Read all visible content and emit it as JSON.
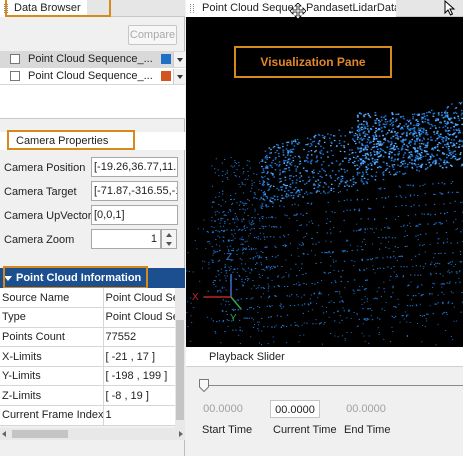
{
  "left": {
    "tab_label": "Data Browser",
    "compare_label": "Compare",
    "datasets": [
      {
        "label": "Point Cloud Sequence_...",
        "color": "#1f6fc4"
      },
      {
        "label": "Point Cloud Sequence_...",
        "color": "#d4541f"
      }
    ],
    "camera": {
      "title": "Camera Properties",
      "position_label": "Camera Position",
      "position_value": "[-19.26,36.77,11.7",
      "target_label": "Camera Target",
      "target_value": "[-71.87,-316.55,-1",
      "upvector_label": "Camera UpVector",
      "upvector_value": "[0,0,1]",
      "zoom_label": "Camera Zoom",
      "zoom_value": "1"
    },
    "pc_info": {
      "title": "Point Cloud Information",
      "rows": [
        {
          "key": "Source Name",
          "value": "Point Cloud Se"
        },
        {
          "key": "Type",
          "value": "Point Cloud Se"
        },
        {
          "key": "Points Count",
          "value": "77552"
        },
        {
          "key": "X-Limits",
          "value": "[ -21 , 17 ]"
        },
        {
          "key": "Y-Limits",
          "value": "[ -198 , 199 ]"
        },
        {
          "key": "Z-Limits",
          "value": "[ -8 , 19 ]"
        },
        {
          "key": "Current Frame Index",
          "value": "1"
        }
      ]
    }
  },
  "right": {
    "tab_label": "Point Cloud Seque... PandasetLidarData",
    "viz_label": "Visualization Pane",
    "axis": {
      "z": "Z",
      "x": "X",
      "y": "Y"
    },
    "playback": {
      "title": "Playback Slider",
      "progress": 0,
      "start_value": "00.0000",
      "current_value": "00.0000",
      "end_value": "00.0000",
      "start_label": "Start Time",
      "current_label": "Current Time",
      "end_label": "End Time"
    }
  },
  "colors": {
    "highlight": "#d78a1c",
    "header_blue": "#1b4f8f",
    "point_blue": "#1f78d8",
    "point_bright": "#5ab0ff"
  }
}
